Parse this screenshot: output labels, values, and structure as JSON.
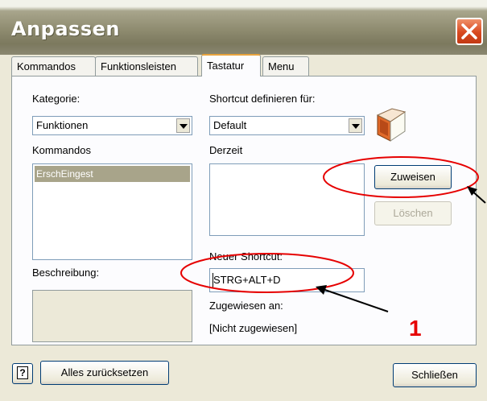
{
  "window": {
    "title": "Anpassen"
  },
  "tabs": [
    "Kommandos",
    "Funktionsleisten",
    "Tastatur",
    "Menu"
  ],
  "left": {
    "kategorie_label": "Kategorie:",
    "kategorie_value": "Funktionen",
    "kommandos_label": "Kommandos",
    "kommandos_items": [
      "ErschEingest"
    ],
    "beschreibung_label": "Beschreibung:"
  },
  "right": {
    "shortcut_for_label": "Shortcut definieren für:",
    "shortcut_for_value": "Default",
    "derzeit_label": "Derzeit",
    "zuweisen_label": "Zuweisen",
    "loeschen_label": "Löschen",
    "neuer_shortcut_label": "Neuer Shortcut:",
    "neuer_shortcut_value": "STRG+ALT+D",
    "zugewiesen_label": "Zugewiesen an:",
    "zugewiesen_value": "[Nicht zugewiesen]"
  },
  "footer": {
    "help_glyph": "?",
    "reset_label": "Alles zurücksetzen",
    "close_label": "Schließen"
  },
  "annotation": {
    "number": "1",
    "color": "#e60000"
  },
  "icons": [
    "close-icon",
    "book-icon",
    "help-icon",
    "chevron-down-icon"
  ]
}
